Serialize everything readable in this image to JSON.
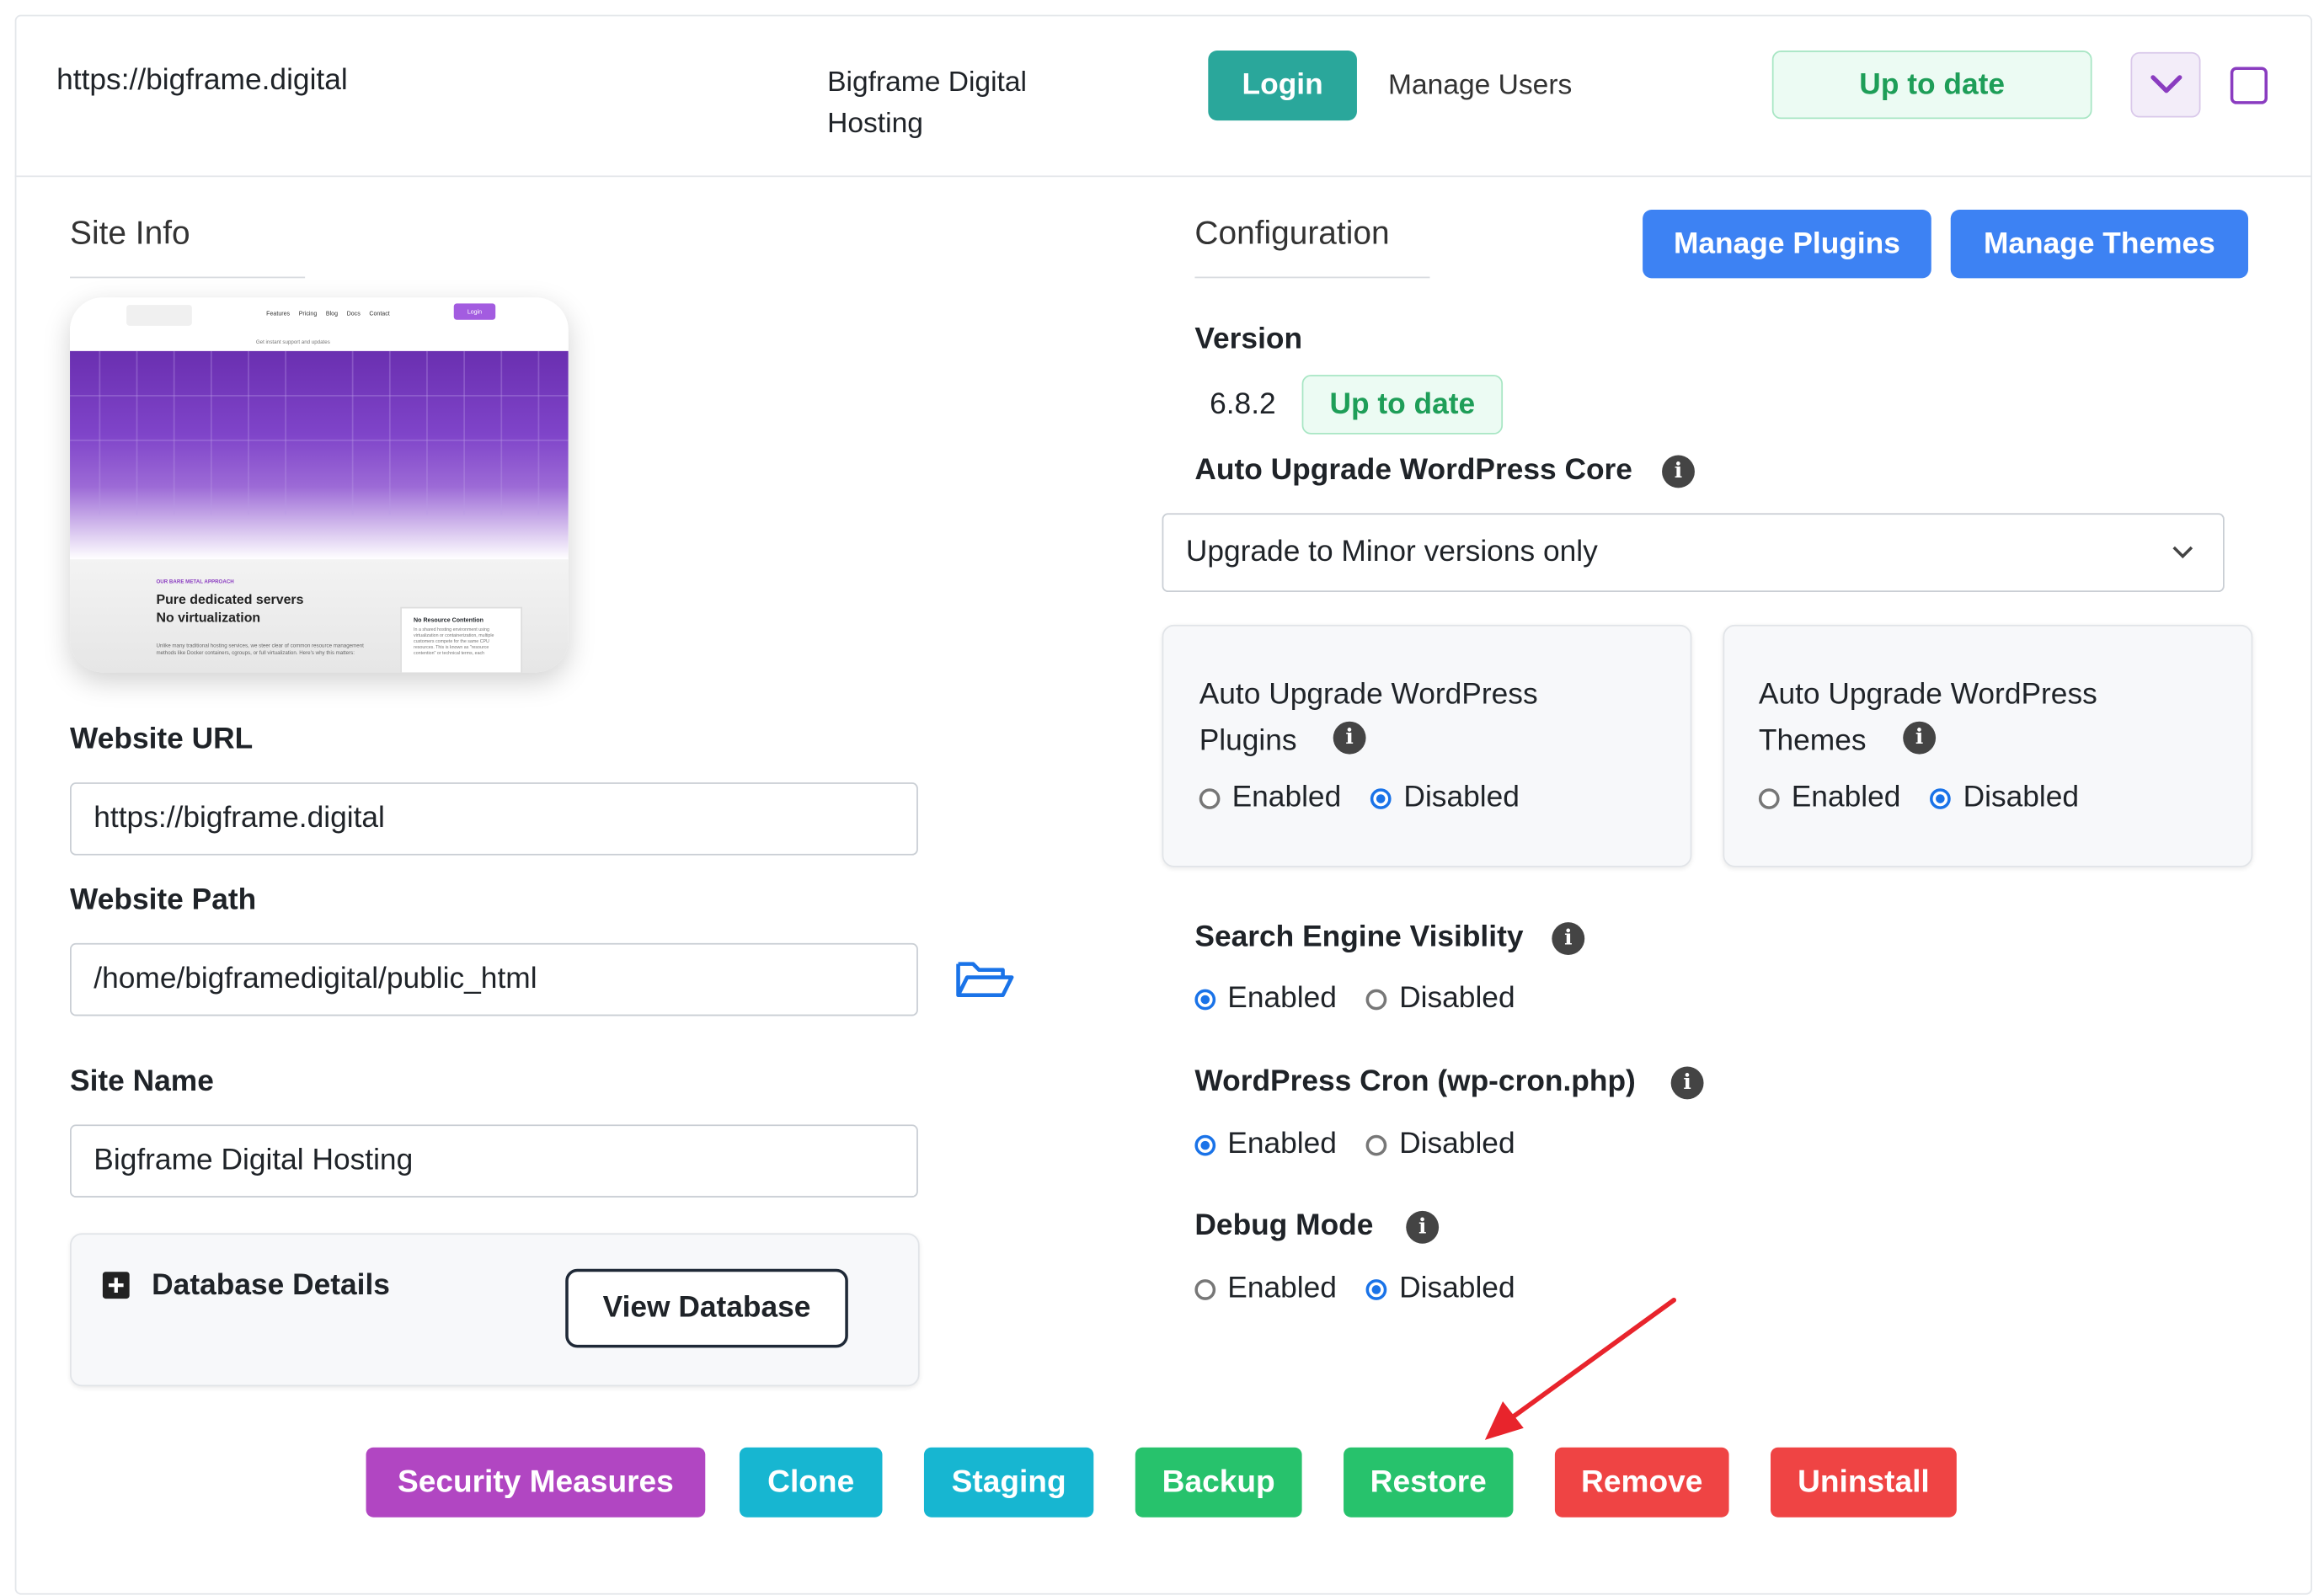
{
  "header": {
    "url": "https://bigframe.digital",
    "site_title_line1": "Bigframe Digital",
    "site_title_line2": "Hosting",
    "login_label": "Login",
    "manage_users_label": "Manage Users",
    "status_badge": "Up to date"
  },
  "site_info": {
    "heading": "Site Info",
    "preview": {
      "nav_items": [
        "Features",
        "Pricing",
        "Blog",
        "Docs",
        "Contact"
      ],
      "nav_button": "Login",
      "tagline_small": "Get instant support and updates",
      "kicker": "OUR BARE METAL APPROACH",
      "headline_line1": "Pure dedicated servers",
      "headline_line2": "No virtualization",
      "body_text": "Unlike many traditional hosting services, we steer clear of common resource management methods like Docker containers, cgroups, or full virtualization. Here's why this matters:",
      "side_card_title": "No Resource Contention",
      "side_card_text": "In a shared hosting environment using virtualization or containerization, multiple customers compete for the same CPU resources. This is known as \"resource contention\" or technical terms, each"
    },
    "website_url_label": "Website URL",
    "website_url_value": "https://bigframe.digital",
    "website_path_label": "Website Path",
    "website_path_value": "/home/bigframedigital/public_html",
    "site_name_label": "Site Name",
    "site_name_value": "Bigframe Digital Hosting",
    "database_details_label": "Database Details",
    "view_database_label": "View Database"
  },
  "configuration": {
    "heading": "Configuration",
    "manage_plugins_label": "Manage Plugins",
    "manage_themes_label": "Manage Themes",
    "version_label": "Version",
    "version_value": "6.8.2",
    "version_status": "Up to date",
    "auto_core_label": "Auto Upgrade WordPress Core",
    "auto_core_value": "Upgrade to Minor versions only",
    "plugins_box": {
      "title_line1": "Auto Upgrade WordPress",
      "title_line2": "Plugins",
      "enabled": "Enabled",
      "disabled": "Disabled",
      "selected": "Disabled"
    },
    "themes_box": {
      "title_line1": "Auto Upgrade WordPress",
      "title_line2": "Themes",
      "enabled": "Enabled",
      "disabled": "Disabled",
      "selected": "Disabled"
    },
    "search_engine": {
      "label": "Search Engine Visiblity",
      "enabled": "Enabled",
      "disabled": "Disabled",
      "selected": "Enabled"
    },
    "cron": {
      "label": "WordPress Cron (wp-cron.php)",
      "enabled": "Enabled",
      "disabled": "Disabled",
      "selected": "Enabled"
    },
    "debug": {
      "label": "Debug Mode",
      "enabled": "Enabled",
      "disabled": "Disabled",
      "selected": "Disabled"
    }
  },
  "actions": {
    "security": "Security Measures",
    "clone": "Clone",
    "staging": "Staging",
    "backup": "Backup",
    "restore": "Restore",
    "remove": "Remove",
    "uninstall": "Uninstall"
  },
  "colors": {
    "teal": "#2aa79b",
    "blue": "#3d82f3",
    "purple": "#b146c2",
    "cyan": "#17b6d1",
    "green": "#27c26c",
    "red": "#ef4444",
    "annotation_arrow": "#e8242c"
  }
}
